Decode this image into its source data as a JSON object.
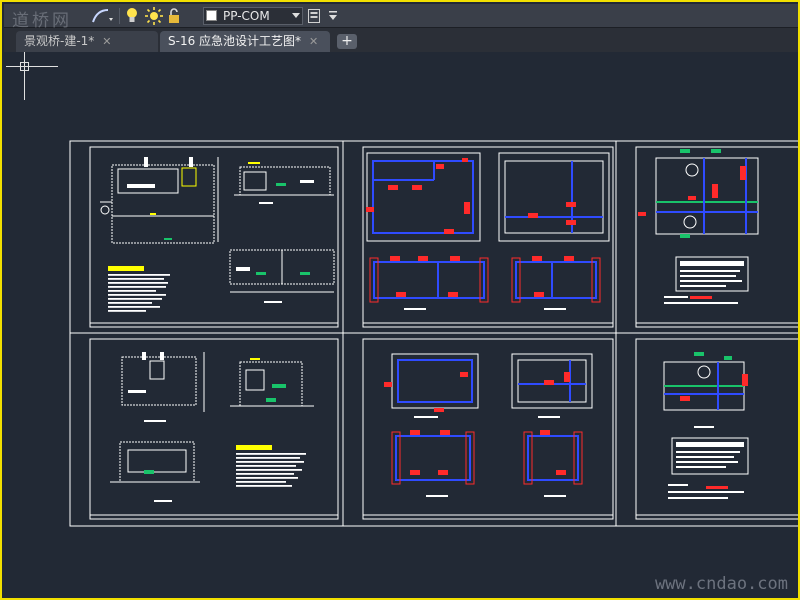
{
  "toolbar": {
    "watermark": "道桥网",
    "layer": {
      "name": "PP-COM",
      "color": "#ffffff"
    },
    "icons": [
      "curve-icon",
      "lightbulb-icon",
      "sun-icon",
      "lock-icon",
      "color-swatch-icon",
      "layer-dropdown-icon",
      "layer-manager-icon",
      "overflow-icon"
    ]
  },
  "tabs": [
    {
      "label": "景观桥-建-1*",
      "close": "✕",
      "active": false
    },
    {
      "label": "S-16 应急池设计工艺图*",
      "close": "✕",
      "active": true
    }
  ],
  "add_tab": "+",
  "canvas": {
    "background": "#222935",
    "watermark": "www.cndao.com"
  },
  "colors": {
    "frame": "#f2e000",
    "sheet_line": "#ffffff",
    "wall": "#2f4bff",
    "rebar": "#ff2a2a",
    "note": "#ffff00",
    "detail": "#19c36a"
  }
}
